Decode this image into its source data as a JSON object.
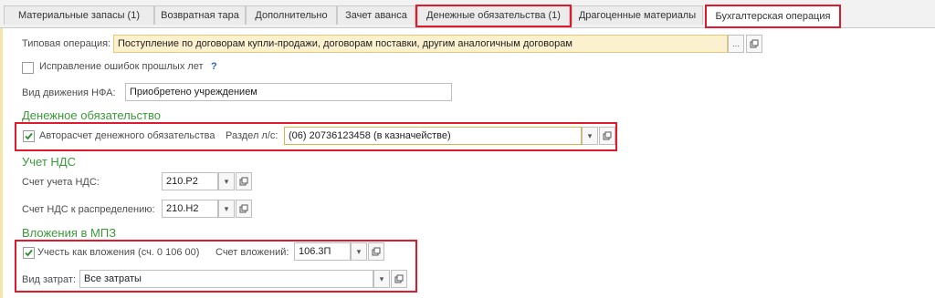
{
  "tabs": [
    {
      "label": "Материальные запасы (1)"
    },
    {
      "label": "Возвратная тара"
    },
    {
      "label": "Дополнительно"
    },
    {
      "label": "Зачет аванса"
    },
    {
      "label": "Денежные обязательства (1)"
    },
    {
      "label": "Драгоценные материалы"
    },
    {
      "label": "Бухгалтерская операция"
    }
  ],
  "form": {
    "typical_op_label": "Типовая операция:",
    "typical_op_value": "Поступление по договорам купли-продажи, договорам поставки, другим аналогичным договорам",
    "error_fix_label": "Исправление ошибок прошлых лет",
    "help_mark": "?",
    "nfa_label": "Вид движения НФА:",
    "nfa_value": "Приобретено учреждением"
  },
  "money": {
    "section_title": "Денежное обязательство",
    "auto_calc_label": "Авторасчет денежного обязательства",
    "auto_calc_checked": true,
    "razdel_label": "Раздел л/с:",
    "razdel_value": "(06) 20736123458 (в казначействе)"
  },
  "vat": {
    "section_title": "Учет НДС",
    "account_label": "Счет учета НДС:",
    "account_value": "210.Р2",
    "distribution_label": "Счет НДС к распределению:",
    "distribution_value": "210.Н2"
  },
  "mpz": {
    "section_title": "Вложения в МПЗ",
    "include_label": "Учесть как вложения (сч. 0 106 00)",
    "include_checked": true,
    "invest_account_label": "Счет вложений:",
    "invest_account_value": "106.3П",
    "cost_type_label": "Вид затрат:",
    "cost_type_value": "Все затраты"
  },
  "icons": {
    "dropdown": "chevron-down-icon",
    "open": "open-form-icon",
    "select": "ellipsis-icon",
    "check": "checkmark-icon"
  },
  "colors": {
    "highlight": "#e1192c",
    "section_green": "#3a9a3a",
    "typical_op_bg": "#fbf1cf"
  }
}
